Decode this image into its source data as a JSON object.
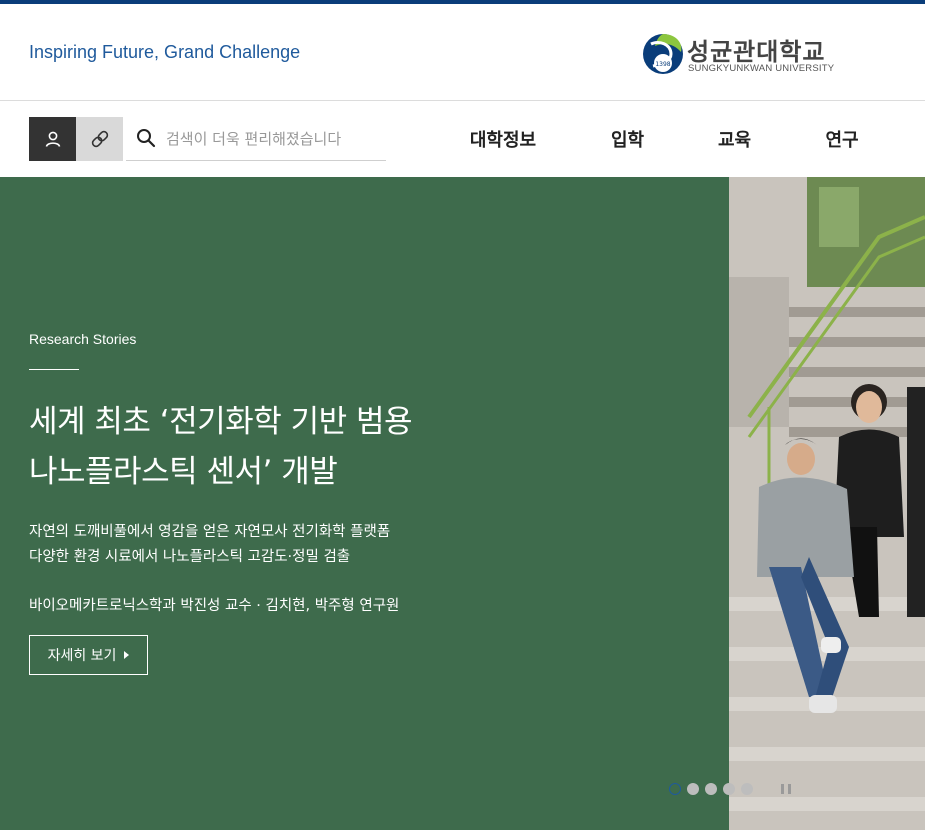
{
  "header": {
    "slogan": "Inspiring Future, Grand Challenge",
    "logo": {
      "name_ko": "성균관대학교",
      "name_en": "SUNGKYUNKWAN UNIVERSITY",
      "year": "1398"
    }
  },
  "toolbar": {
    "user_icon": "user-icon",
    "link_icon": "link-icon",
    "search": {
      "placeholder": "검색이 더욱 편리해졌습니다",
      "value": ""
    }
  },
  "nav": {
    "items": [
      {
        "label": "대학정보"
      },
      {
        "label": "입학"
      },
      {
        "label": "교육"
      },
      {
        "label": "연구"
      }
    ]
  },
  "hero": {
    "kicker": "Research Stories",
    "title_line1": "세계 최초 ‘전기화학 기반 범용",
    "title_line2": "나노플라스틱 센서’ 개발",
    "desc_line1": "자연의 도깨비풀에서 영감을 얻은 자연모사 전기화학 플랫폼",
    "desc_line2": "다양한 환경 시료에서 나노플라스틱 고감도·정밀 검출",
    "byline": "바이오메카트로닉스학과 박진성 교수 · 김치현, 박주형 연구원",
    "more_label": "자세히 보기",
    "slides_total": 5,
    "slide_active": 1
  },
  "colors": {
    "brand_blue": "#0a3d7a",
    "slogan_blue": "#1f5a9c",
    "hero_green": "#3e6b4c",
    "logo_green": "#8cc63f"
  }
}
